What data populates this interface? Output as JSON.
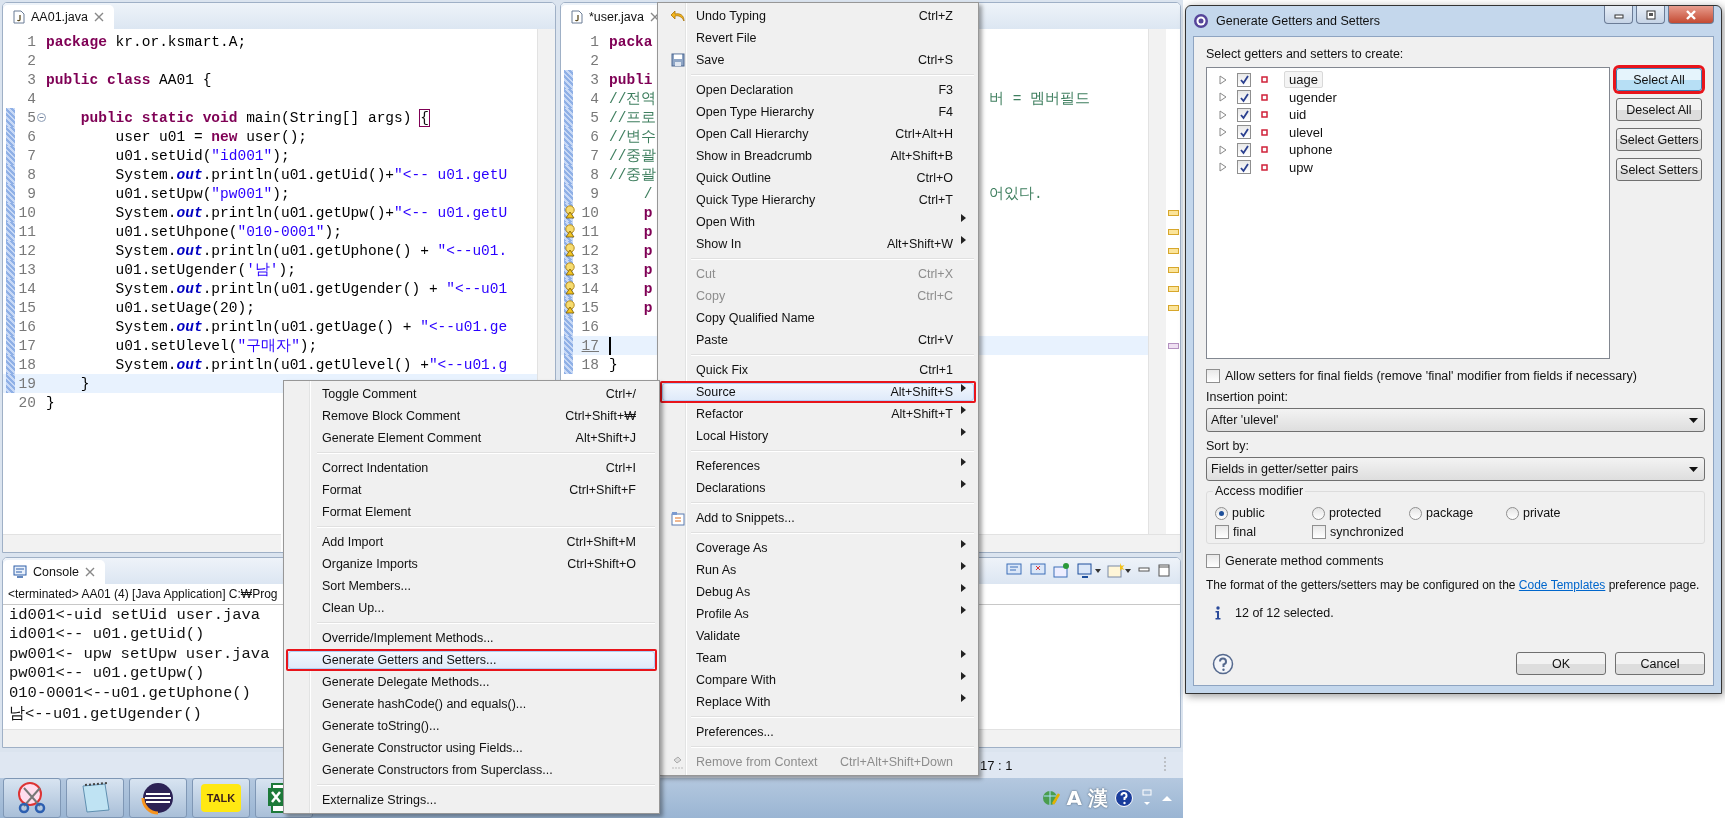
{
  "left_editor": {
    "tab": "AA01.java",
    "lines": [
      {
        "number": "1",
        "changed": false,
        "current": false,
        "fold": false,
        "tokens": [
          {
            "kind": "keyword",
            "text": "package"
          },
          {
            "kind": "plain",
            "text": " kr.or.ksmart.A;"
          }
        ]
      },
      {
        "number": "2",
        "changed": false,
        "current": false,
        "fold": false
      },
      {
        "number": "3",
        "changed": false,
        "current": false,
        "fold": false,
        "tokens": [
          {
            "kind": "keyword",
            "text": "public class"
          },
          {
            "kind": "plain",
            "text": " AA01 {"
          }
        ]
      },
      {
        "number": "4",
        "changed": false,
        "current": false,
        "fold": false
      },
      {
        "number": "5",
        "changed": true,
        "current": false,
        "fold": true,
        "tokens": [
          {
            "kind": "keyword",
            "text": "    public static void"
          },
          {
            "kind": "plain",
            "text": " main(String[] args) "
          },
          {
            "kind": "bracket",
            "text": "{"
          }
        ]
      },
      {
        "number": "6",
        "changed": true,
        "current": false,
        "fold": false,
        "tokens": [
          {
            "kind": "plain",
            "text": "        user u01 = "
          },
          {
            "kind": "keyword",
            "text": "new"
          },
          {
            "kind": "plain",
            "text": " user();"
          }
        ]
      },
      {
        "number": "7",
        "changed": true,
        "current": false,
        "fold": false,
        "tokens": [
          {
            "kind": "plain",
            "text": "        u01.setUid("
          },
          {
            "kind": "string",
            "text": "\"id001\""
          },
          {
            "kind": "plain",
            "text": ");"
          }
        ]
      },
      {
        "number": "8",
        "changed": true,
        "current": false,
        "fold": false,
        "tokens": [
          {
            "kind": "plain",
            "text": "        System."
          },
          {
            "kind": "field",
            "text": "out"
          },
          {
            "kind": "plain",
            "text": ".println(u01.getUid()+"
          },
          {
            "kind": "string",
            "text": "\"<-- u01.getU"
          }
        ]
      },
      {
        "number": "9",
        "changed": true,
        "current": false,
        "fold": false,
        "tokens": [
          {
            "kind": "plain",
            "text": "        u01.setUpw("
          },
          {
            "kind": "string",
            "text": "\"pw001\""
          },
          {
            "kind": "plain",
            "text": ");"
          }
        ]
      },
      {
        "number": "10",
        "changed": true,
        "current": false,
        "fold": false,
        "tokens": [
          {
            "kind": "plain",
            "text": "        System."
          },
          {
            "kind": "field",
            "text": "out"
          },
          {
            "kind": "plain",
            "text": ".println(u01.getUpw()+"
          },
          {
            "kind": "string",
            "text": "\"<-- u01.getU"
          }
        ]
      },
      {
        "number": "11",
        "changed": true,
        "current": false,
        "fold": false,
        "tokens": [
          {
            "kind": "plain",
            "text": "        u01.setUhpone("
          },
          {
            "kind": "string",
            "text": "\"010-0001\""
          },
          {
            "kind": "plain",
            "text": ");"
          }
        ]
      },
      {
        "number": "12",
        "changed": true,
        "current": false,
        "fold": false,
        "tokens": [
          {
            "kind": "plain",
            "text": "        System."
          },
          {
            "kind": "field",
            "text": "out"
          },
          {
            "kind": "plain",
            "text": ".println(u01.getUphone() + "
          },
          {
            "kind": "string",
            "text": "\"<--u01."
          }
        ]
      },
      {
        "number": "13",
        "changed": true,
        "current": false,
        "fold": false,
        "tokens": [
          {
            "kind": "plain",
            "text": "        u01.setUgender("
          },
          {
            "kind": "string",
            "text": "'남'"
          },
          {
            "kind": "plain",
            "text": ");"
          }
        ]
      },
      {
        "number": "14",
        "changed": true,
        "current": false,
        "fold": false,
        "tokens": [
          {
            "kind": "plain",
            "text": "        System."
          },
          {
            "kind": "field",
            "text": "out"
          },
          {
            "kind": "plain",
            "text": ".println(u01.getUgender() + "
          },
          {
            "kind": "string",
            "text": "\"<--u01"
          }
        ]
      },
      {
        "number": "15",
        "changed": true,
        "current": false,
        "fold": false,
        "tokens": [
          {
            "kind": "plain",
            "text": "        u01.setUage(20);"
          }
        ]
      },
      {
        "number": "16",
        "changed": true,
        "current": false,
        "fold": false,
        "tokens": [
          {
            "kind": "plain",
            "text": "        System."
          },
          {
            "kind": "field",
            "text": "out"
          },
          {
            "kind": "plain",
            "text": ".println(u01.getUage() + "
          },
          {
            "kind": "string",
            "text": "\"<--u01.ge"
          }
        ]
      },
      {
        "number": "17",
        "changed": true,
        "current": false,
        "fold": false,
        "tokens": [
          {
            "kind": "plain",
            "text": "        u01.setUlevel("
          },
          {
            "kind": "string",
            "text": "\"구매자\""
          },
          {
            "kind": "plain",
            "text": ");"
          }
        ]
      },
      {
        "number": "18",
        "changed": true,
        "current": false,
        "fold": false,
        "tokens": [
          {
            "kind": "plain",
            "text": "        System."
          },
          {
            "kind": "field",
            "text": "out"
          },
          {
            "kind": "plain",
            "text": ".println(u01.getUlevel() +"
          },
          {
            "kind": "string",
            "text": "\"<--u01.g"
          }
        ]
      },
      {
        "number": "19",
        "changed": true,
        "current": true,
        "fold": false,
        "tokens": [
          {
            "kind": "plain",
            "text": "    }"
          }
        ]
      },
      {
        "number": "20",
        "changed": false,
        "current": false,
        "fold": false,
        "tokens": [
          {
            "kind": "plain",
            "text": "}"
          }
        ]
      }
    ]
  },
  "right_editor": {
    "tab": "*user.java",
    "lines": [
      {
        "number": "1",
        "changed": false,
        "current": false,
        "warning": false,
        "tokens": [
          {
            "kind": "keyword",
            "text": "packa"
          }
        ]
      },
      {
        "number": "2",
        "changed": false,
        "current": false,
        "warning": false
      },
      {
        "number": "3",
        "changed": true,
        "current": false,
        "warning": false,
        "tokens": [
          {
            "kind": "keyword",
            "text": "publi"
          }
        ]
      },
      {
        "number": "4",
        "changed": true,
        "current": false,
        "warning": false,
        "tokens": [
          {
            "kind": "comment",
            "text": "//전역"
          }
        ],
        "tail": "버 = 멤버필드"
      },
      {
        "number": "5",
        "changed": true,
        "current": false,
        "warning": false,
        "tokens": [
          {
            "kind": "comment",
            "text": "//프로"
          }
        ]
      },
      {
        "number": "6",
        "changed": true,
        "current": false,
        "warning": false,
        "tokens": [
          {
            "kind": "comment",
            "text": "//변수"
          }
        ]
      },
      {
        "number": "7",
        "changed": true,
        "current": false,
        "warning": false,
        "tokens": [
          {
            "kind": "comment",
            "text": "//중괄"
          }
        ]
      },
      {
        "number": "8",
        "changed": true,
        "current": false,
        "warning": false,
        "tokens": [
          {
            "kind": "comment",
            "text": "//중괄"
          }
        ]
      },
      {
        "number": "9",
        "changed": true,
        "current": false,
        "warning": false,
        "tokens": [
          {
            "kind": "comment",
            "text": "    /"
          }
        ],
        "tail": "어있다."
      },
      {
        "number": "10",
        "changed": true,
        "current": false,
        "warning": true,
        "tokens": [
          {
            "kind": "keyword",
            "text": "    p"
          }
        ]
      },
      {
        "number": "11",
        "changed": true,
        "current": false,
        "warning": true,
        "tokens": [
          {
            "kind": "keyword",
            "text": "    p"
          }
        ]
      },
      {
        "number": "12",
        "changed": true,
        "current": false,
        "warning": true,
        "tokens": [
          {
            "kind": "keyword",
            "text": "    p"
          }
        ]
      },
      {
        "number": "13",
        "changed": true,
        "current": false,
        "warning": true,
        "tokens": [
          {
            "kind": "keyword",
            "text": "    p"
          }
        ]
      },
      {
        "number": "14",
        "changed": true,
        "current": false,
        "warning": true,
        "tokens": [
          {
            "kind": "keyword",
            "text": "    p"
          }
        ]
      },
      {
        "number": "15",
        "changed": true,
        "current": false,
        "warning": true,
        "tokens": [
          {
            "kind": "keyword",
            "text": "    p"
          }
        ]
      },
      {
        "number": "16",
        "changed": true,
        "current": false,
        "warning": false
      },
      {
        "number": "17",
        "changed": true,
        "current": true,
        "warning": false
      },
      {
        "number": "18",
        "changed": true,
        "current": false,
        "warning": false,
        "tokens": [
          {
            "kind": "plain",
            "text": "}"
          }
        ]
      }
    ]
  },
  "console": {
    "tab": "Console",
    "header": "<terminated> AA01 (4) [Java Application] C:₩Prog",
    "lines": [
      "id001<-uid setUid user.java",
      "id001<-- u01.getUid()",
      "pw001<- upw setUpw user.java",
      "pw001<-- u01.getUpw()",
      "010-0001<--u01.getUphone()",
      "남<--u01.getUgender()"
    ]
  },
  "status_bar": {
    "position": "17 : 1"
  },
  "taskbar": {
    "apps": [
      {
        "kind": "scissors"
      },
      {
        "kind": "notepad"
      },
      {
        "kind": "eclipse"
      },
      {
        "kind": "talk",
        "label": "TALK"
      },
      {
        "kind": "excel"
      }
    ],
    "tray": {
      "input_mode": "A",
      "hanja": "漢"
    }
  },
  "context_menu": {
    "groups": [
      [
        {
          "label": "Undo Typing",
          "shortcut": "Ctrl+Z",
          "kind": "undo",
          "submenu": false,
          "disabled": false,
          "selected": false,
          "highlighted": false
        },
        {
          "label": "Revert File",
          "submenu": false,
          "disabled": false,
          "selected": false,
          "highlighted": false
        },
        {
          "label": "Save",
          "shortcut": "Ctrl+S",
          "kind": "save",
          "submenu": false,
          "disabled": false,
          "selected": false,
          "highlighted": false
        }
      ],
      [
        {
          "label": "Open Declaration",
          "shortcut": "F3",
          "submenu": false,
          "disabled": false,
          "selected": false,
          "highlighted": false
        },
        {
          "label": "Open Type Hierarchy",
          "shortcut": "F4",
          "submenu": false,
          "disabled": false,
          "selected": false,
          "highlighted": false
        },
        {
          "label": "Open Call Hierarchy",
          "shortcut": "Ctrl+Alt+H",
          "submenu": false,
          "disabled": false,
          "selected": false,
          "highlighted": false
        },
        {
          "label": "Show in Breadcrumb",
          "shortcut": "Alt+Shift+B",
          "submenu": false,
          "disabled": false,
          "selected": false,
          "highlighted": false
        },
        {
          "label": "Quick Outline",
          "shortcut": "Ctrl+O",
          "submenu": false,
          "disabled": false,
          "selected": false,
          "highlighted": false
        },
        {
          "label": "Quick Type Hierarchy",
          "shortcut": "Ctrl+T",
          "submenu": false,
          "disabled": false,
          "selected": false,
          "highlighted": false
        },
        {
          "label": "Open With",
          "submenu": true,
          "disabled": false,
          "selected": false,
          "highlighted": false
        },
        {
          "label": "Show In",
          "shortcut": "Alt+Shift+W",
          "submenu": true,
          "disabled": false,
          "selected": false,
          "highlighted": false
        }
      ],
      [
        {
          "label": "Cut",
          "shortcut": "Ctrl+X",
          "submenu": false,
          "disabled": true,
          "selected": false,
          "highlighted": false
        },
        {
          "label": "Copy",
          "shortcut": "Ctrl+C",
          "submenu": false,
          "disabled": true,
          "selected": false,
          "highlighted": false
        },
        {
          "label": "Copy Qualified Name",
          "submenu": false,
          "disabled": false,
          "selected": false,
          "highlighted": false
        },
        {
          "label": "Paste",
          "shortcut": "Ctrl+V",
          "submenu": false,
          "disabled": false,
          "selected": false,
          "highlighted": false
        }
      ],
      [
        {
          "label": "Quick Fix",
          "shortcut": "Ctrl+1",
          "submenu": false,
          "disabled": false,
          "selected": false,
          "highlighted": false
        },
        {
          "label": "Source",
          "shortcut": "Alt+Shift+S",
          "submenu": true,
          "disabled": false,
          "selected": true,
          "highlighted": true
        },
        {
          "label": "Refactor",
          "shortcut": "Alt+Shift+T",
          "submenu": true,
          "disabled": false,
          "selected": false,
          "highlighted": false
        },
        {
          "label": "Local History",
          "submenu": true,
          "disabled": false,
          "selected": false,
          "highlighted": false
        }
      ],
      [
        {
          "label": "References",
          "submenu": true,
          "disabled": false,
          "selected": false,
          "highlighted": false
        },
        {
          "label": "Declarations",
          "submenu": true,
          "disabled": false,
          "selected": false,
          "highlighted": false
        }
      ],
      [
        {
          "label": "Add to Snippets...",
          "kind": "snippet",
          "submenu": false,
          "disabled": false,
          "selected": false,
          "highlighted": false
        }
      ],
      [
        {
          "label": "Coverage As",
          "submenu": true,
          "disabled": false,
          "selected": false,
          "highlighted": false
        },
        {
          "label": "Run As",
          "submenu": true,
          "disabled": false,
          "selected": false,
          "highlighted": false
        },
        {
          "label": "Debug As",
          "submenu": true,
          "disabled": false,
          "selected": false,
          "highlighted": false
        },
        {
          "label": "Profile As",
          "submenu": true,
          "disabled": false,
          "selected": false,
          "highlighted": false
        },
        {
          "label": "Validate",
          "submenu": false,
          "disabled": false,
          "selected": false,
          "highlighted": false
        },
        {
          "label": "Team",
          "submenu": true,
          "disabled": false,
          "selected": false,
          "highlighted": false
        },
        {
          "label": "Compare With",
          "submenu": true,
          "disabled": false,
          "selected": false,
          "highlighted": false
        },
        {
          "label": "Replace With",
          "submenu": true,
          "disabled": false,
          "selected": false,
          "highlighted": false
        }
      ],
      [
        {
          "label": "Preferences...",
          "submenu": false,
          "disabled": false,
          "selected": false,
          "highlighted": false
        }
      ],
      [
        {
          "label": "Remove from Context",
          "shortcut": "Ctrl+Alt+Shift+Down",
          "kind": "remove",
          "submenu": false,
          "disabled": true,
          "selected": false,
          "highlighted": false
        }
      ]
    ]
  },
  "source_menu": {
    "groups": [
      [
        {
          "label": "Toggle Comment",
          "shortcut": "Ctrl+/",
          "selected": false,
          "highlighted": false
        },
        {
          "label": "Remove Block Comment",
          "shortcut": "Ctrl+Shift+₩",
          "selected": false,
          "highlighted": false
        },
        {
          "label": "Generate Element Comment",
          "shortcut": "Alt+Shift+J",
          "selected": false,
          "highlighted": false
        }
      ],
      [
        {
          "label": "Correct Indentation",
          "shortcut": "Ctrl+I",
          "selected": false,
          "highlighted": false
        },
        {
          "label": "Format",
          "shortcut": "Ctrl+Shift+F",
          "selected": false,
          "highlighted": false
        },
        {
          "label": "Format Element",
          "selected": false,
          "highlighted": false
        }
      ],
      [
        {
          "label": "Add Import",
          "shortcut": "Ctrl+Shift+M",
          "selected": false,
          "highlighted": false
        },
        {
          "label": "Organize Imports",
          "shortcut": "Ctrl+Shift+O",
          "selected": false,
          "highlighted": false
        },
        {
          "label": "Sort Members...",
          "selected": false,
          "highlighted": false
        },
        {
          "label": "Clean Up...",
          "selected": false,
          "highlighted": false
        }
      ],
      [
        {
          "label": "Override/Implement Methods...",
          "selected": false,
          "highlighted": false
        },
        {
          "label": "Generate Getters and Setters...",
          "selected": true,
          "highlighted": true
        },
        {
          "label": "Generate Delegate Methods...",
          "selected": false,
          "highlighted": false
        },
        {
          "label": "Generate hashCode() and equals()...",
          "selected": false,
          "highlighted": false
        },
        {
          "label": "Generate toString()...",
          "selected": false,
          "highlighted": false
        },
        {
          "label": "Generate Constructor using Fields...",
          "selected": false,
          "highlighted": false
        },
        {
          "label": "Generate Constructors from Superclass...",
          "selected": false,
          "highlighted": false
        }
      ],
      [
        {
          "label": "Externalize Strings...",
          "selected": false,
          "highlighted": false
        }
      ]
    ]
  },
  "dialog": {
    "title": "Generate Getters and Setters",
    "prompt": "Select getters and setters to create:",
    "fields": [
      {
        "name": "uage",
        "checked": true,
        "selected": true
      },
      {
        "name": "ugender",
        "checked": true,
        "selected": false
      },
      {
        "name": "uid",
        "checked": true,
        "selected": false
      },
      {
        "name": "ulevel",
        "checked": true,
        "selected": false
      },
      {
        "name": "uphone",
        "checked": true,
        "selected": false
      },
      {
        "name": "upw",
        "checked": true,
        "selected": false
      }
    ],
    "buttons": [
      {
        "label": "Select All",
        "highlighted": true
      },
      {
        "label": "Deselect All",
        "highlighted": false
      },
      {
        "label": "Select Getters",
        "highlighted": false
      },
      {
        "label": "Select Setters",
        "highlighted": false
      }
    ],
    "allow_final": {
      "label": "Allow setters for final fields (remove 'final' modifier from fields if necessary)",
      "checked": false
    },
    "insertion_point": {
      "label": "Insertion point:",
      "value": "After 'ulevel'"
    },
    "sort_by": {
      "label": "Sort by:",
      "value": "Fields in getter/setter pairs"
    },
    "access": {
      "title": "Access modifier",
      "options": [
        {
          "label": "public",
          "selected": true
        },
        {
          "label": "protected",
          "selected": false
        },
        {
          "label": "package",
          "selected": false
        },
        {
          "label": "private",
          "selected": false
        }
      ],
      "modifiers": [
        {
          "label": "final",
          "checked": false
        },
        {
          "label": "synchronized",
          "checked": false
        }
      ]
    },
    "comments": {
      "label": "Generate method comments",
      "checked": false
    },
    "note": {
      "before": "The format of the getters/setters may be configured on the ",
      "link": "Code Templates",
      "after": " preference page."
    },
    "status": "12 of 12 selected.",
    "actions": [
      {
        "label": "OK"
      },
      {
        "label": "Cancel"
      }
    ]
  }
}
